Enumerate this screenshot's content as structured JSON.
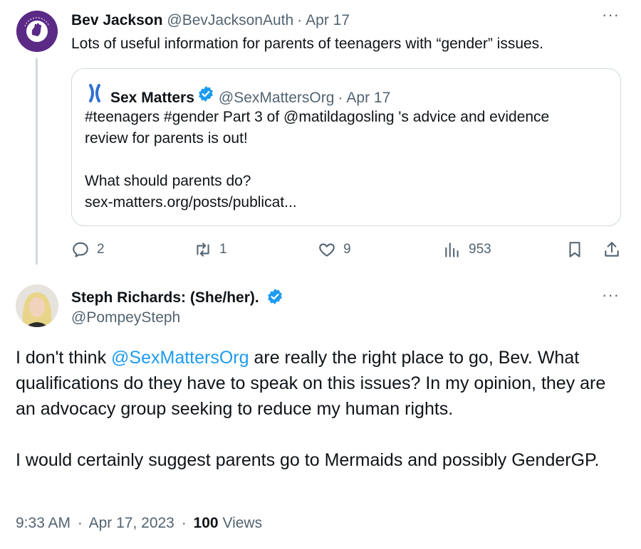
{
  "original_tweet": {
    "display_name": "Bev Jackson",
    "handle": "@BevJacksonAuth",
    "date": "Apr 17",
    "text": "Lots of useful information for parents of teenagers with “gender” issues.",
    "avatar_text": "GAY LIBERATION FRONT",
    "stats": {
      "replies": "2",
      "retweets": "1",
      "likes": "9",
      "views": "953"
    }
  },
  "quoted_tweet": {
    "display_name": "Sex Matters",
    "handle": "@SexMattersOrg",
    "date": "Apr 17",
    "text": "#teenagers #gender  Part 3 of @matildagosling 's advice and evidence\nreview for parents is out!\n\nWhat should parents do?\n sex-matters.org/posts/publicat..."
  },
  "reply": {
    "display_name": "Steph Richards: (She/her).",
    "handle": "@PompeySteph",
    "text_before_mention": "I don't think ",
    "mention": "@SexMattersOrg",
    "text_after_mention": " are really the right place to go, Bev. What qualifications do they have to speak on this issues?  In my opinion, they are an advocacy group seeking to reduce my human rights.",
    "text_paragraph_2": "I would certainly suggest parents go to Mermaids and possibly GenderGP.",
    "time": "9:33 AM",
    "date": "Apr 17, 2023",
    "views_count": "100",
    "views_label": "Views"
  },
  "ui": {
    "more_glyph": "···",
    "separator": "·"
  },
  "colors": {
    "accent": "#1d9bf0",
    "muted": "#536471",
    "border": "#cfd9de",
    "text": "#0f1419",
    "chromosome_icon": "#2f6fd0"
  }
}
